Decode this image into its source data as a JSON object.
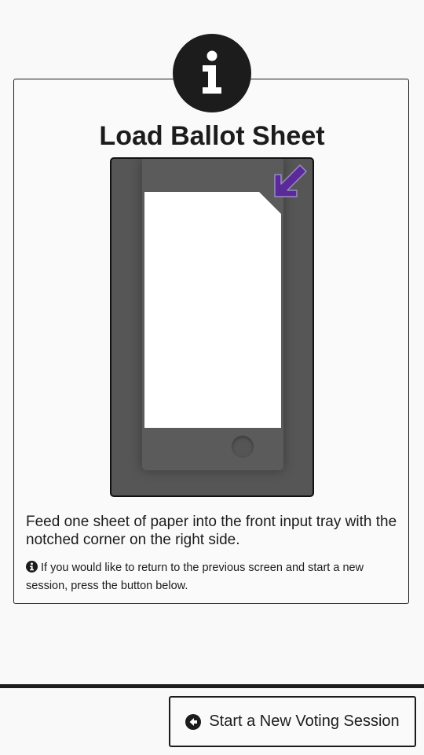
{
  "card": {
    "title": "Load Ballot Sheet",
    "instructions": "Feed one sheet of paper into the front input tray with the notched corner on the right side.",
    "note": "If you would like to return to the previous screen and start a new session, press the button below.",
    "icon": "info-icon"
  },
  "illustration": {
    "device_icon": "printer-tray-icon",
    "arrow_icon": "arrow-down-left-icon",
    "arrow_color": "#5b2a9a"
  },
  "footer": {
    "start_button_label": "Start a New Voting Session",
    "start_button_icon": "arrow-circle-left-icon"
  },
  "colors": {
    "text": "#1c1c1c",
    "background": "#f9f9f9",
    "accent": "#5b2a9a"
  }
}
